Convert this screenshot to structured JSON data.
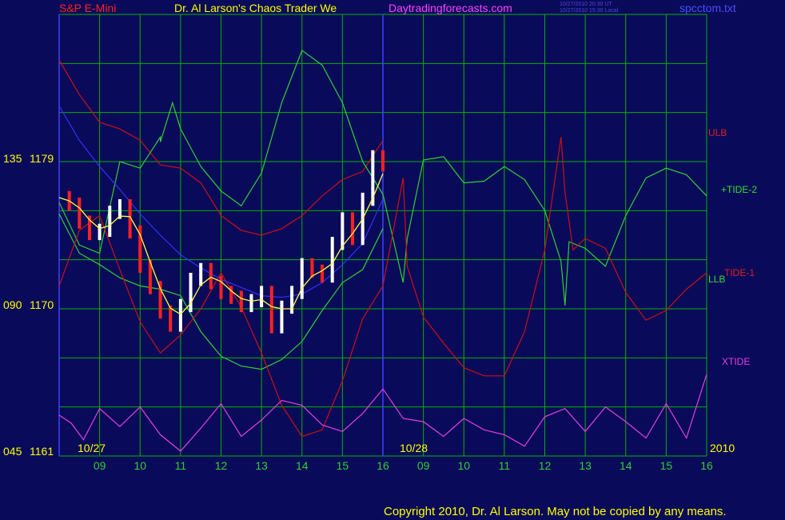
{
  "header": {
    "symbol": "S&P E-Mini",
    "author": "Dr. Al Larson's Chaos Trader We",
    "site": "Daytradingforecasts.com",
    "ut_time": "10/27/2010 20:30 UT",
    "local_time": "10/27/2010 15:30 Local",
    "filename": "spcctom.txt"
  },
  "footer": {
    "copyright": "Copyright 2010, Dr. Al Larson. May not be copied by any means."
  },
  "colors": {
    "background": "#0a0a5a",
    "grid": "#00b400",
    "divider": "#4040ff",
    "price_up": "#ffffff",
    "price_down": "#ff2020",
    "moving_avg": "#ffff40",
    "ulb": "#cc1010",
    "llb": "#30d030",
    "tide2": "#30d030",
    "tide1": "#cc1010",
    "xtide": "#e040e0",
    "projection": "#3030ff"
  },
  "chart_data": {
    "type": "line",
    "title": "S&P E-Mini",
    "y_labels": [
      {
        "code": "135",
        "price": "1179"
      },
      {
        "code": "090",
        "price": "1170"
      },
      {
        "code": "045",
        "price": "1161"
      }
    ],
    "ylim": [
      1161,
      1188
    ],
    "x_ticks": [
      "09",
      "10",
      "11",
      "12",
      "13",
      "14",
      "15",
      "16",
      "09",
      "10",
      "11",
      "12",
      "13",
      "14",
      "15",
      "16"
    ],
    "date_labels": {
      "day1": "10/27",
      "day2": "10/28",
      "year": "2010"
    },
    "xlim": [
      0,
      16
    ],
    "grid": true,
    "right_labels": {
      "ulb": "ULB",
      "tide2": "+TIDE-2",
      "tide1": "TIDE-1",
      "llb": "LLB",
      "xtide": "XTIDE"
    },
    "price_series": [
      [
        0,
        1176.8
      ],
      [
        0.25,
        1176.4
      ],
      [
        0.5,
        1175.3
      ],
      [
        0.75,
        1174.6
      ],
      [
        1.0,
        1174.8
      ],
      [
        1.25,
        1175.9
      ],
      [
        1.5,
        1176.3
      ],
      [
        1.75,
        1174.7
      ],
      [
        2.0,
        1172.6
      ],
      [
        2.25,
        1171.3
      ],
      [
        2.5,
        1169.8
      ],
      [
        2.75,
        1169.0
      ],
      [
        3.0,
        1170.2
      ],
      [
        3.25,
        1171.8
      ],
      [
        3.5,
        1172.4
      ],
      [
        3.75,
        1171.6
      ],
      [
        4.0,
        1171.0
      ],
      [
        4.25,
        1170.7
      ],
      [
        4.5,
        1170.2
      ],
      [
        4.75,
        1170.5
      ],
      [
        5.0,
        1171.0
      ],
      [
        5.25,
        1168.9
      ],
      [
        5.5,
        1170.1
      ],
      [
        5.75,
        1171.0
      ],
      [
        6.0,
        1172.7
      ],
      [
        6.25,
        1172.3
      ],
      [
        6.5,
        1172.0
      ],
      [
        6.75,
        1174.0
      ],
      [
        7.0,
        1175.5
      ],
      [
        7.25,
        1174.3
      ],
      [
        7.5,
        1176.7
      ],
      [
        7.75,
        1179.3
      ],
      [
        8.0,
        1178.8
      ]
    ],
    "series": [
      {
        "name": "ULB",
        "points": [
          [
            0,
            1185.2
          ],
          [
            0.5,
            1183.1
          ],
          [
            1.0,
            1181.4
          ],
          [
            1.5,
            1181.0
          ],
          [
            2.0,
            1180.3
          ],
          [
            2.5,
            1178.8
          ],
          [
            3.0,
            1178.6
          ],
          [
            3.5,
            1177.7
          ],
          [
            4.0,
            1175.7
          ],
          [
            4.5,
            1174.8
          ],
          [
            5.0,
            1174.5
          ],
          [
            5.5,
            1174.9
          ],
          [
            6.0,
            1175.7
          ],
          [
            6.5,
            1176.9
          ],
          [
            7.0,
            1177.9
          ],
          [
            7.5,
            1178.4
          ],
          [
            8.0,
            1180.3
          ]
        ]
      },
      {
        "name": "LLB",
        "points": [
          [
            0,
            1175.8
          ],
          [
            0.5,
            1173.4
          ],
          [
            1.0,
            1172.7
          ],
          [
            1.5,
            1171.9
          ],
          [
            2.0,
            1171.4
          ],
          [
            2.5,
            1171.2
          ],
          [
            3.0,
            1170.8
          ],
          [
            3.5,
            1168.6
          ],
          [
            4.0,
            1167.1
          ],
          [
            4.5,
            1166.5
          ],
          [
            5.0,
            1166.3
          ],
          [
            5.5,
            1166.9
          ],
          [
            6.0,
            1168.0
          ],
          [
            6.5,
            1169.9
          ],
          [
            7.0,
            1171.6
          ],
          [
            7.5,
            1172.4
          ],
          [
            8.0,
            1174.9
          ]
        ]
      },
      {
        "name": "+TIDE-2",
        "points": [
          [
            0,
            1176.5
          ],
          [
            0.5,
            1173.9
          ],
          [
            1.0,
            1173.4
          ],
          [
            1.5,
            1179.0
          ],
          [
            2.0,
            1178.6
          ],
          [
            2.5,
            1180.5
          ],
          [
            2.5,
            1180.2
          ],
          [
            2.8,
            1182.6
          ],
          [
            3.0,
            1181.0
          ],
          [
            3.5,
            1178.7
          ],
          [
            4.0,
            1177.2
          ],
          [
            4.5,
            1176.3
          ],
          [
            5.0,
            1178.3
          ],
          [
            5.5,
            1182.6
          ],
          [
            6.0,
            1185.8
          ],
          [
            6.5,
            1184.9
          ],
          [
            7.0,
            1182.6
          ],
          [
            7.5,
            1179.0
          ],
          [
            8.0,
            1177.0
          ],
          [
            8.5,
            1171.6
          ],
          [
            8.6,
            1174.3
          ],
          [
            9.0,
            1179.1
          ],
          [
            9.5,
            1179.3
          ],
          [
            10.0,
            1177.7
          ],
          [
            10.5,
            1177.8
          ],
          [
            11.0,
            1178.7
          ],
          [
            11.5,
            1177.9
          ],
          [
            12.0,
            1176.0
          ],
          [
            12.4,
            1172.9
          ],
          [
            12.5,
            1170.2
          ],
          [
            12.6,
            1174.1
          ],
          [
            13.0,
            1173.7
          ],
          [
            13.5,
            1172.6
          ],
          [
            14.0,
            1175.7
          ],
          [
            14.5,
            1178.0
          ],
          [
            15.0,
            1178.6
          ],
          [
            15.5,
            1178.2
          ],
          [
            16,
            1176.9
          ]
        ]
      },
      {
        "name": "TIDE-1",
        "points": [
          [
            0,
            1171.4
          ],
          [
            0.5,
            1174.8
          ],
          [
            1.0,
            1175.7
          ],
          [
            1.5,
            1172.4
          ],
          [
            2.0,
            1169.2
          ],
          [
            2.5,
            1167.3
          ],
          [
            3.0,
            1168.4
          ],
          [
            3.5,
            1170.0
          ],
          [
            4.0,
            1172.2
          ],
          [
            4.5,
            1170.1
          ],
          [
            5.0,
            1167.3
          ],
          [
            5.5,
            1164.1
          ],
          [
            6.0,
            1162.2
          ],
          [
            6.5,
            1162.6
          ],
          [
            7.0,
            1165.6
          ],
          [
            7.5,
            1169.4
          ],
          [
            8.0,
            1171.4
          ],
          [
            8.5,
            1178.0
          ],
          [
            8.6,
            1172.6
          ],
          [
            9.0,
            1169.5
          ],
          [
            9.5,
            1167.9
          ],
          [
            10.0,
            1166.4
          ],
          [
            10.5,
            1165.9
          ],
          [
            11.0,
            1165.9
          ],
          [
            11.5,
            1168.6
          ],
          [
            12.0,
            1173.6
          ],
          [
            12.4,
            1180.5
          ],
          [
            12.5,
            1177.1
          ],
          [
            12.7,
            1173.6
          ],
          [
            13.0,
            1174.3
          ],
          [
            13.5,
            1173.7
          ],
          [
            14.0,
            1171.0
          ],
          [
            14.5,
            1169.3
          ],
          [
            15.0,
            1169.9
          ],
          [
            15.5,
            1171.2
          ],
          [
            16,
            1172.2
          ]
        ]
      },
      {
        "name": "XTIDE",
        "points": [
          [
            0,
            1163.5
          ],
          [
            0.3,
            1163.0
          ],
          [
            0.6,
            1162.0
          ],
          [
            1.0,
            1163.9
          ],
          [
            1.5,
            1162.8
          ],
          [
            2.0,
            1164.0
          ],
          [
            2.5,
            1162.3
          ],
          [
            3.0,
            1161.3
          ],
          [
            3.5,
            1162.7
          ],
          [
            4.0,
            1164.2
          ],
          [
            4.5,
            1162.2
          ],
          [
            5.0,
            1163.2
          ],
          [
            5.5,
            1164.4
          ],
          [
            6.0,
            1164.1
          ],
          [
            6.5,
            1162.9
          ],
          [
            7.0,
            1162.5
          ],
          [
            7.5,
            1163.6
          ],
          [
            8.0,
            1165.1
          ],
          [
            8.5,
            1163.3
          ],
          [
            9.0,
            1163.1
          ],
          [
            9.5,
            1162.2
          ],
          [
            10.0,
            1163.3
          ],
          [
            10.5,
            1162.6
          ],
          [
            11.0,
            1162.3
          ],
          [
            11.5,
            1161.6
          ],
          [
            12.0,
            1163.4
          ],
          [
            12.5,
            1163.9
          ],
          [
            13.0,
            1162.5
          ],
          [
            13.5,
            1164.0
          ],
          [
            14.0,
            1163.1
          ],
          [
            14.5,
            1162.1
          ],
          [
            15.0,
            1164.2
          ],
          [
            15.5,
            1162.1
          ],
          [
            16,
            1166.0
          ]
        ]
      },
      {
        "name": "projection",
        "points": [
          [
            0,
            1182.4
          ],
          [
            0.5,
            1180.3
          ],
          [
            1.0,
            1178.7
          ],
          [
            1.5,
            1177.3
          ],
          [
            2.0,
            1175.8
          ],
          [
            2.5,
            1174.5
          ],
          [
            3.0,
            1173.3
          ],
          [
            3.5,
            1172.5
          ],
          [
            4.0,
            1171.8
          ],
          [
            4.5,
            1171.3
          ],
          [
            5.0,
            1170.8
          ],
          [
            5.5,
            1170.7
          ],
          [
            6.0,
            1170.9
          ],
          [
            6.5,
            1171.6
          ],
          [
            7.0,
            1172.7
          ],
          [
            7.5,
            1174.0
          ],
          [
            8.0,
            1176.7
          ]
        ]
      }
    ]
  }
}
